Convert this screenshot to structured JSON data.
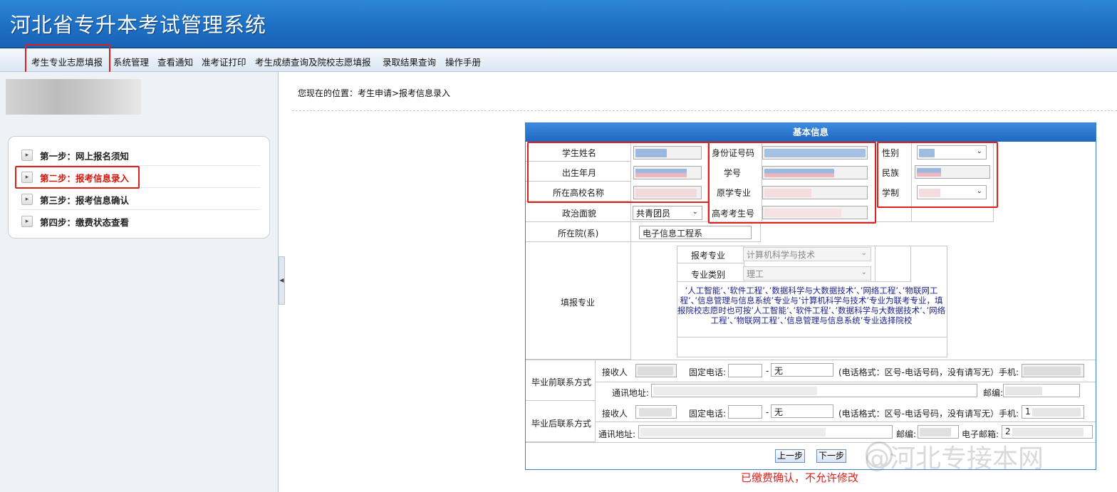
{
  "app": {
    "title": "河北省专升本考试管理系统"
  },
  "menu": [
    {
      "label": "考生专业志愿填报"
    },
    {
      "label": "系统管理"
    },
    {
      "label": "查看通知"
    },
    {
      "label": "准考证打印"
    },
    {
      "label": "考生成绩查询及院校志愿填报"
    },
    {
      "label": "录取结果查询"
    },
    {
      "label": "操作手册"
    }
  ],
  "steps": [
    {
      "label": "第一步：网上报名须知",
      "active": false
    },
    {
      "label": "第二步：报考信息录入",
      "active": true
    },
    {
      "label": "第三步：报考信息确认",
      "active": false
    },
    {
      "label": "第四步：缴费状态查看",
      "active": false
    }
  ],
  "breadcrumb": "您现在的位置：考生申请>报考信息录入",
  "form": {
    "heading": "基本信息",
    "labels": {
      "name": "学生姓名",
      "id_number": "身份证号码",
      "gender": "性别",
      "birth": "出生年月",
      "student_no": "学号",
      "ethnicity": "民族",
      "school": "所在高校名称",
      "orig_major": "原学专业",
      "schooling": "学制",
      "politics": "政治面貌",
      "gaokao_no": "高考考生号",
      "department": "所在院(系)",
      "apply_major": "报考专业",
      "major_type": "专业类别",
      "fill_major": "填报专业",
      "before_grad": "毕业前联系方式",
      "after_grad": "毕业后联系方式",
      "receiver": "接收人",
      "landline": "固定电话:",
      "phone_format": "(电话格式：区号-电话号码，没有请写无）手机:",
      "address": "通讯地址:",
      "zip": "邮编:",
      "email": "电子邮箱:"
    },
    "values": {
      "politics": "共青团员",
      "department": "电子信息工程系",
      "apply_major": "计算机科学与技术",
      "major_type": "理工",
      "landline_before": "无",
      "landline_after": "无",
      "phone_after_prefix": "1",
      "email_prefix": "2"
    },
    "note": "’人工智能’、’软件工程’、’数据科学与大数据技术’、’网络工程’、’物联网工程’、’信息管理与信息系统’专业与’计算机科学与技术’专业为联考专业，填报院校志愿时也可按’人工智能’、’软件工程’、’数据科学与大数据技术’、’网络工程’、’物联网工程’、’信息管理与信息系统’专业选择院校",
    "buttons": {
      "prev": "上一步",
      "next": "下一步"
    }
  },
  "warning": "已缴费确认，不允许修改",
  "watermark": "@河北专接本网",
  "colors": {
    "header": "#1d6fc4",
    "highlight_box": "#e0201c",
    "active_step": "#d9160c"
  }
}
